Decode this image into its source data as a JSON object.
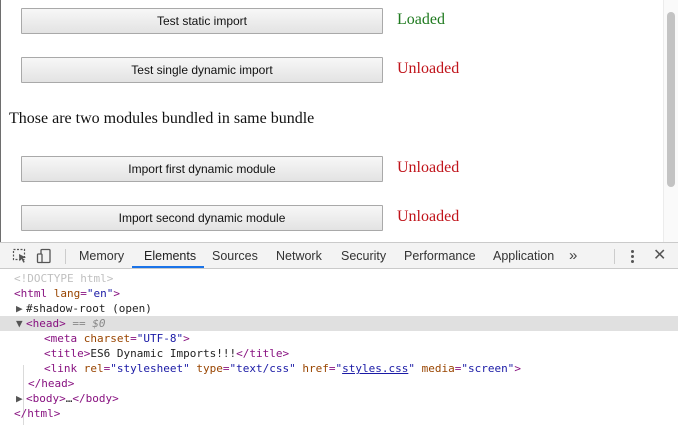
{
  "page": {
    "rows": [
      {
        "button": "Test static import",
        "status": "Loaded",
        "state": "loaded"
      },
      {
        "button": "Test single dynamic import",
        "status": "Unloaded",
        "state": "unloaded"
      },
      {
        "button": "Import first dynamic module",
        "status": "Unloaded",
        "state": "unloaded"
      },
      {
        "button": "Import second dynamic module",
        "status": "Unloaded",
        "state": "unloaded"
      }
    ],
    "paragraph": "Those are two modules bundled in same bundle"
  },
  "devtools": {
    "toolbar_icons": [
      "inspect-element-icon",
      "device-toolbar-icon"
    ],
    "tabs": [
      "Memory",
      "Elements",
      "Sources",
      "Network",
      "Security",
      "Performance",
      "Application"
    ],
    "active_tab": "Elements",
    "overflow": "»",
    "close": "✕",
    "dom": {
      "doctype": "<!DOCTYPE html>",
      "html_tag": "html",
      "html_lang_attr": "lang",
      "html_lang_value": "\"en\"",
      "shadow_root": "#shadow-root (open)",
      "head_tag": "head",
      "dollar_zero": "== $0",
      "meta_tag": "meta",
      "meta_attr": "charset",
      "meta_value": "\"UTF-8\"",
      "title_tag": "title",
      "title_text": "ES6 Dynamic Imports!!!",
      "link_tag": "link",
      "link_rel_attr": "rel",
      "link_rel_value": "\"stylesheet\"",
      "link_type_attr": "type",
      "link_type_value": "\"text/css\"",
      "link_href_attr": "href",
      "link_href_value": "styles.css",
      "link_media_attr": "media",
      "link_media_value": "\"screen\"",
      "body_tag": "body",
      "ellipsis": "…"
    }
  },
  "colors": {
    "loaded": "#1f7a1f",
    "unloaded": "#c0141b",
    "active_tab_underline": "#1a73e8",
    "tag": "#881280",
    "attr_name": "#994500",
    "attr_value": "#1a1aa6"
  }
}
